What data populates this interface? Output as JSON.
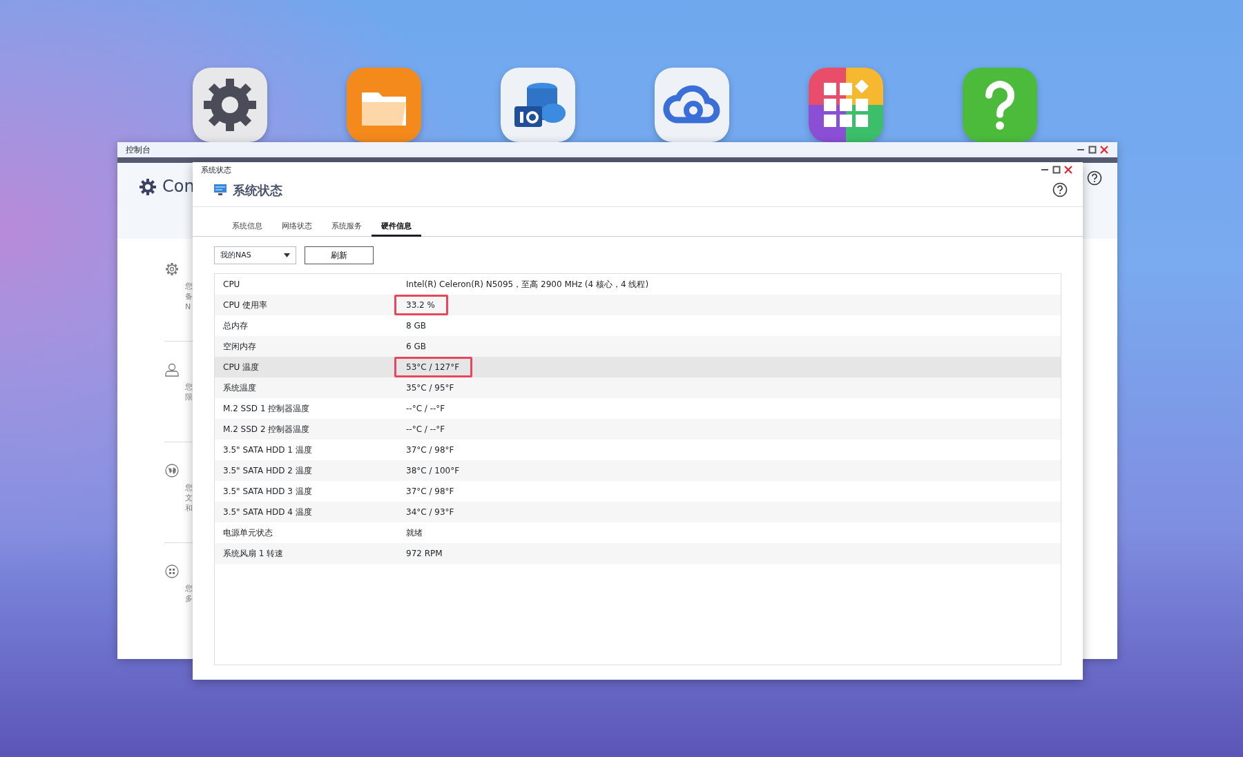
{
  "dock": [
    {
      "kind": "settings"
    },
    {
      "kind": "files"
    },
    {
      "kind": "storage"
    },
    {
      "kind": "cloud"
    },
    {
      "kind": "apps"
    },
    {
      "kind": "help"
    }
  ],
  "back_window": {
    "title": "控制台",
    "heading": "Con",
    "sections": [
      {
        "kind": "settings",
        "description": [
          "您",
          "备",
          "N"
        ]
      },
      {
        "kind": "user",
        "description": [
          "您",
          "限"
        ]
      },
      {
        "kind": "network",
        "description": [
          "您",
          "文",
          "和"
        ]
      },
      {
        "kind": "apps",
        "description": [
          "您",
          "多"
        ]
      }
    ]
  },
  "window": {
    "title": "系统状态",
    "heading": "系统状态",
    "tabs": [
      {
        "label": "系统信息",
        "selected": false
      },
      {
        "label": "网络状态",
        "selected": false
      },
      {
        "label": "系统服务",
        "selected": false
      },
      {
        "label": "硬件信息",
        "selected": true
      }
    ],
    "device_select": {
      "value": "我的NAS"
    },
    "refresh_button": "刷新",
    "table": {
      "rows": [
        {
          "label": "CPU",
          "value": "Intel(R) Celeron(R) N5095，至高 2900 MHz (4 核心，4 线程)",
          "highlighted": false,
          "selected": false
        },
        {
          "label": "CPU 使用率",
          "value": "33.2 %",
          "highlighted": true,
          "selected": false
        },
        {
          "label": "总内存",
          "value": "8 GB",
          "highlighted": false,
          "selected": false
        },
        {
          "label": "空闲内存",
          "value": "6 GB",
          "highlighted": false,
          "selected": false
        },
        {
          "label": "CPU 温度",
          "value": "53°C / 127°F",
          "highlighted": true,
          "selected": true
        },
        {
          "label": "系统温度",
          "value": "35°C / 95°F",
          "highlighted": false,
          "selected": false
        },
        {
          "label": "M.2 SSD 1 控制器温度",
          "value": "--°C / --°F",
          "highlighted": false,
          "selected": false
        },
        {
          "label": "M.2 SSD 2 控制器温度",
          "value": "--°C / --°F",
          "highlighted": false,
          "selected": false
        },
        {
          "label": "3.5\" SATA HDD 1 温度",
          "value": "37°C / 98°F",
          "highlighted": false,
          "selected": false
        },
        {
          "label": "3.5\" SATA HDD 2 温度",
          "value": "38°C / 100°F",
          "highlighted": false,
          "selected": false
        },
        {
          "label": "3.5\" SATA HDD 3 温度",
          "value": "37°C / 98°F",
          "highlighted": false,
          "selected": false
        },
        {
          "label": "3.5\" SATA HDD 4 温度",
          "value": "34°C / 93°F",
          "highlighted": false,
          "selected": false
        },
        {
          "label": "电源单元状态",
          "value": "就绪",
          "highlighted": false,
          "selected": false
        },
        {
          "label": "系统风扇 1 转速",
          "value": "972 RPM",
          "highlighted": false,
          "selected": false
        }
      ]
    }
  }
}
